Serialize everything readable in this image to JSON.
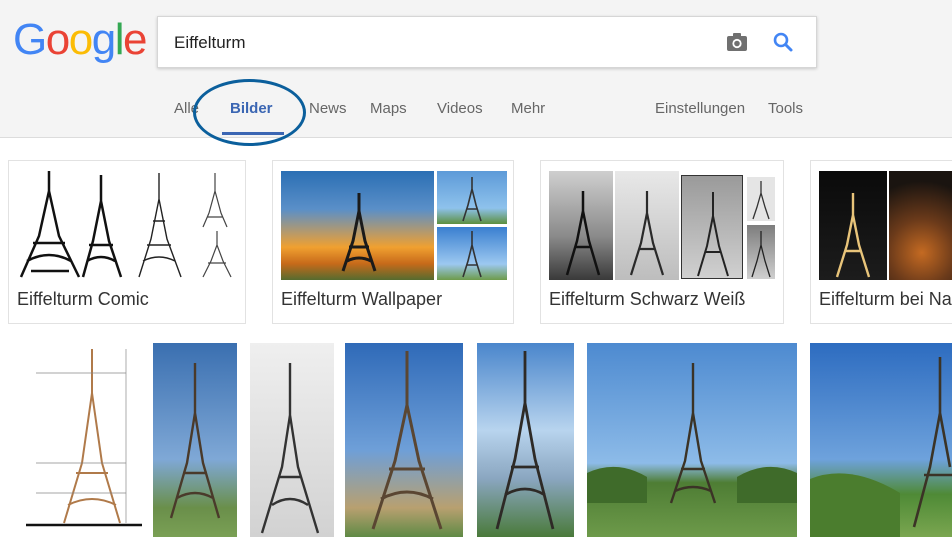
{
  "logo": {
    "letters": [
      "G",
      "o",
      "o",
      "g",
      "l",
      "e"
    ],
    "colors": [
      "#4285f4",
      "#ea4335",
      "#fbbc05",
      "#4285f4",
      "#34a853",
      "#ea4335"
    ]
  },
  "search": {
    "value": "Eiffelturm",
    "camera_icon": "camera-icon",
    "search_icon": "search-icon"
  },
  "nav": {
    "items": [
      {
        "label": "Alle"
      },
      {
        "label": "Bilder",
        "active": true
      },
      {
        "label": "News"
      },
      {
        "label": "Maps"
      },
      {
        "label": "Videos"
      },
      {
        "label": "Mehr"
      },
      {
        "label": "Einstellungen"
      },
      {
        "label": "Tools"
      }
    ]
  },
  "related": [
    {
      "label": "Eiffelturm Comic"
    },
    {
      "label": "Eiffelturm Wallpaper"
    },
    {
      "label": "Eiffelturm Schwarz Weiß"
    },
    {
      "label": "Eiffelturm bei Na"
    }
  ],
  "colors": {
    "accent": "#3b66b3",
    "annotation": "#0b5f9c"
  }
}
